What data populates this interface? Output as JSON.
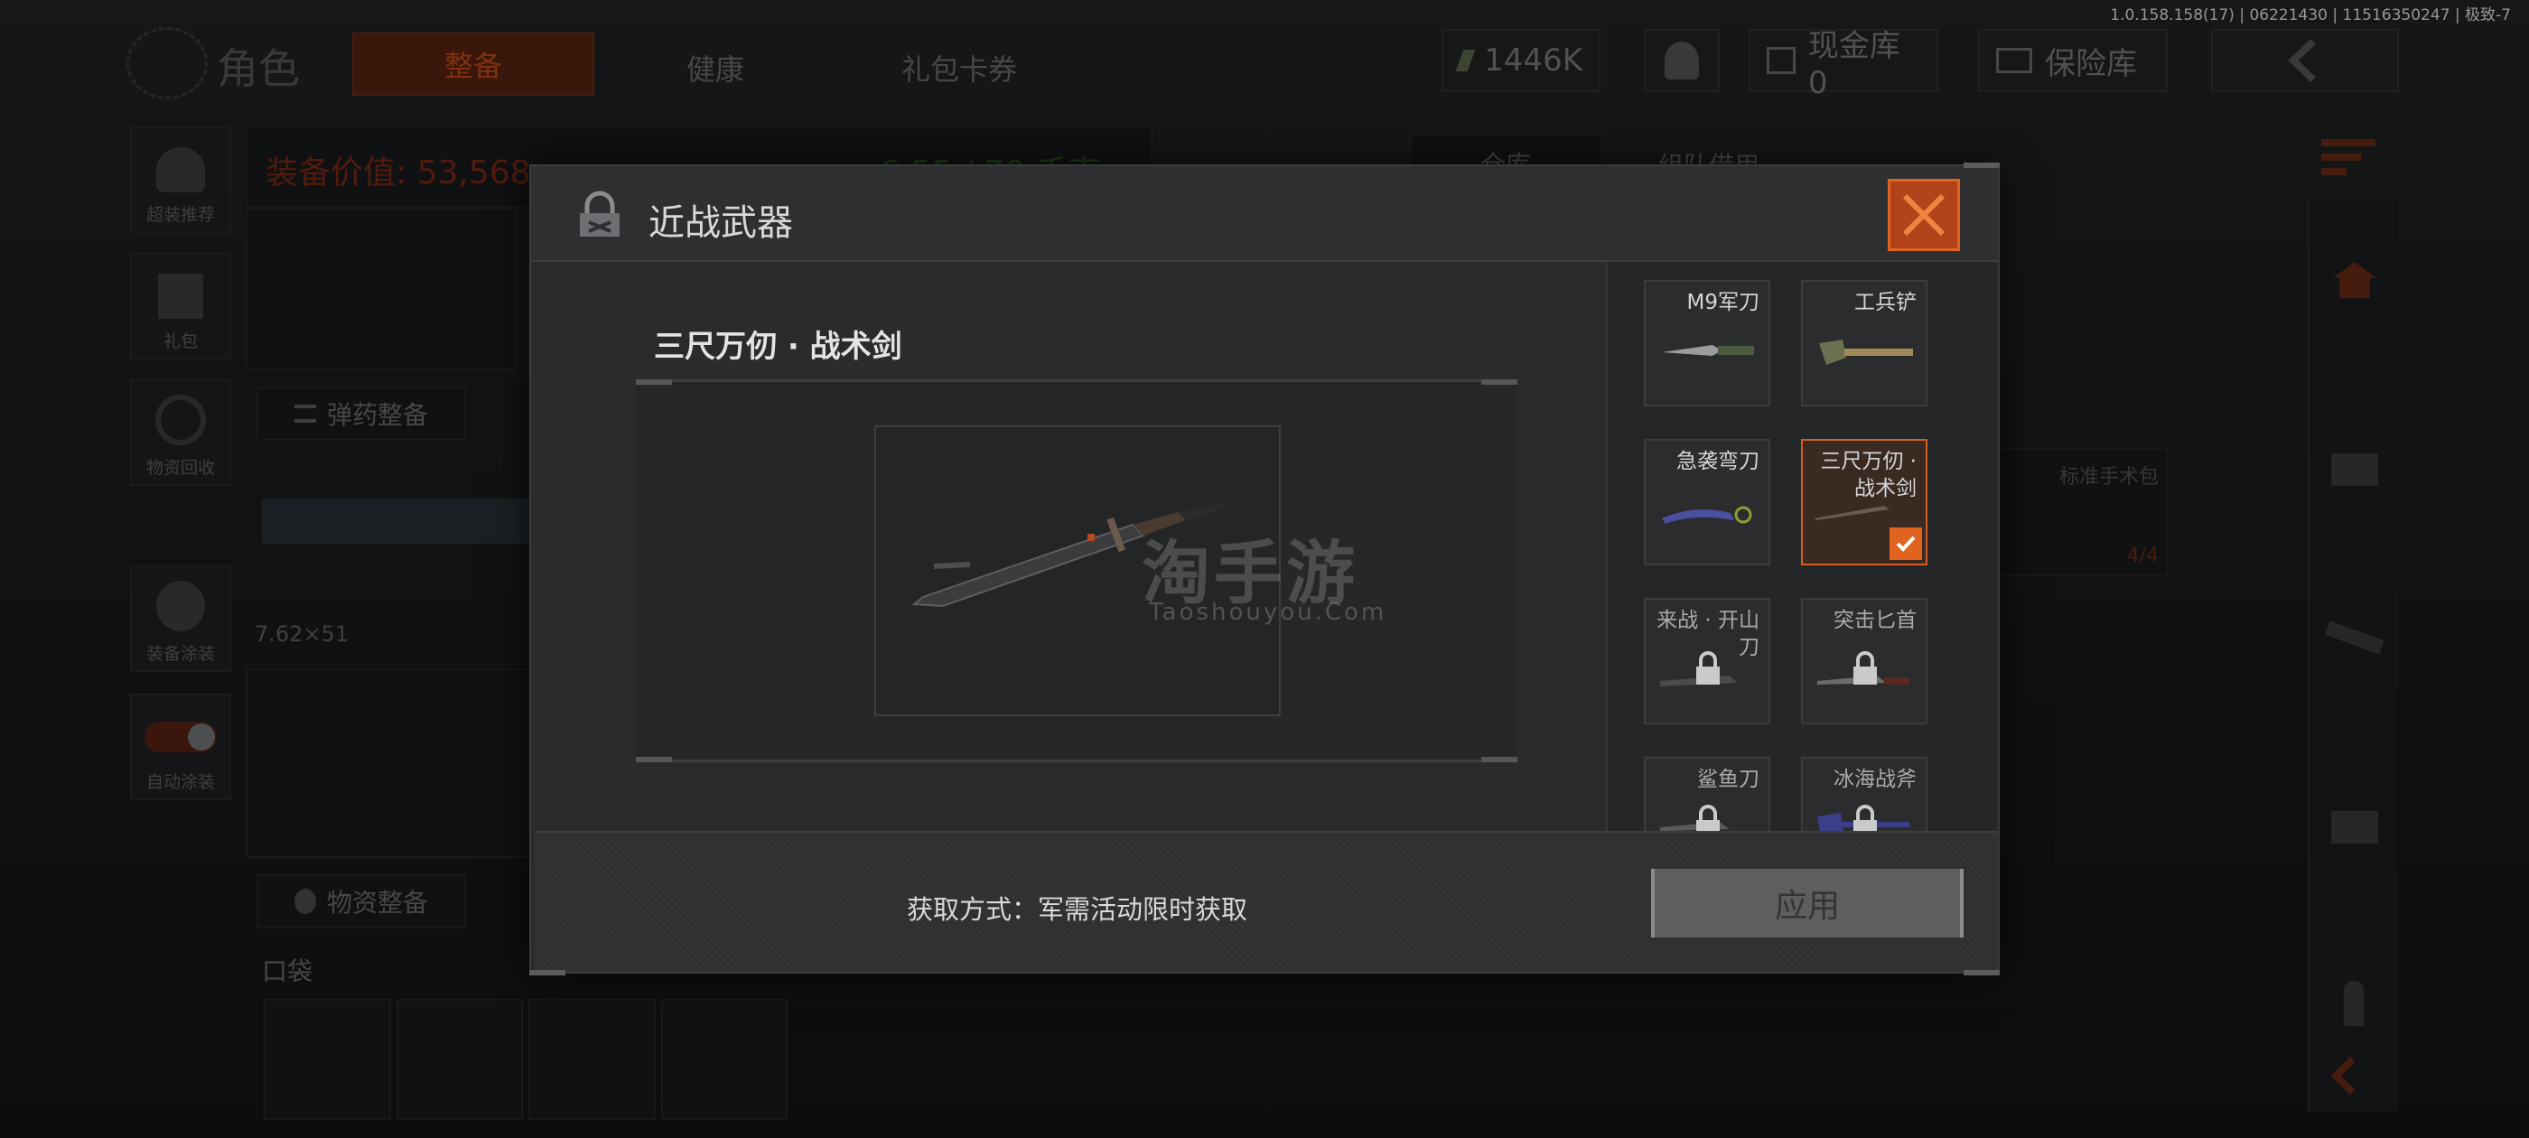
{
  "version_info": "1.0.158.158(17) | 06221430 | 11516350247 | 极致-7",
  "background": {
    "header_title": "角色",
    "tabs": [
      "整备",
      "健康",
      "礼包卡券"
    ],
    "currency": "1446K",
    "vault_label": "现金库 0",
    "insurance_label": "保险库",
    "equipment_value_label": "装备价值: 53,568",
    "weight_label": "6.55 / 70 千克",
    "side_buttons": [
      "超装推荐",
      "礼包",
      "物资回收",
      "装备涂装",
      "自动涂装"
    ],
    "ammo_button": "弹药整备",
    "caliber": "7.62×51",
    "supply_button": "物资整备",
    "pocket_label": "口袋",
    "warehouse_tabs": [
      "仓库",
      "组队借用"
    ],
    "grenade_label": "标准手术包",
    "grenade_count": "4/4"
  },
  "modal": {
    "title": "近战武器",
    "preview_name": "三尺万仞 · 战术剑",
    "watermark": "淘手游",
    "watermark_sub": "Taoshouyou.Com",
    "acquire_text": "获取方式：军需活动限时获取",
    "apply_label": "应用",
    "items": [
      {
        "name": "M9军刀",
        "locked": false,
        "selected": false
      },
      {
        "name": "工兵铲",
        "locked": false,
        "selected": false
      },
      {
        "name": "急袭弯刀",
        "locked": false,
        "selected": false
      },
      {
        "name": "三尺万仞 · 战术剑",
        "locked": false,
        "selected": true
      },
      {
        "name": "来战 · 开山刀",
        "locked": true,
        "selected": false
      },
      {
        "name": "突击匕首",
        "locked": true,
        "selected": false
      },
      {
        "name": "鲨鱼刀",
        "locked": true,
        "selected": false
      },
      {
        "name": "冰海战斧",
        "locked": true,
        "selected": false
      }
    ]
  },
  "colors": {
    "accent": "#e0631f",
    "selected_border": "#d45e24",
    "equipment_value": "#b2391a",
    "weight": "#3f7a2c"
  }
}
